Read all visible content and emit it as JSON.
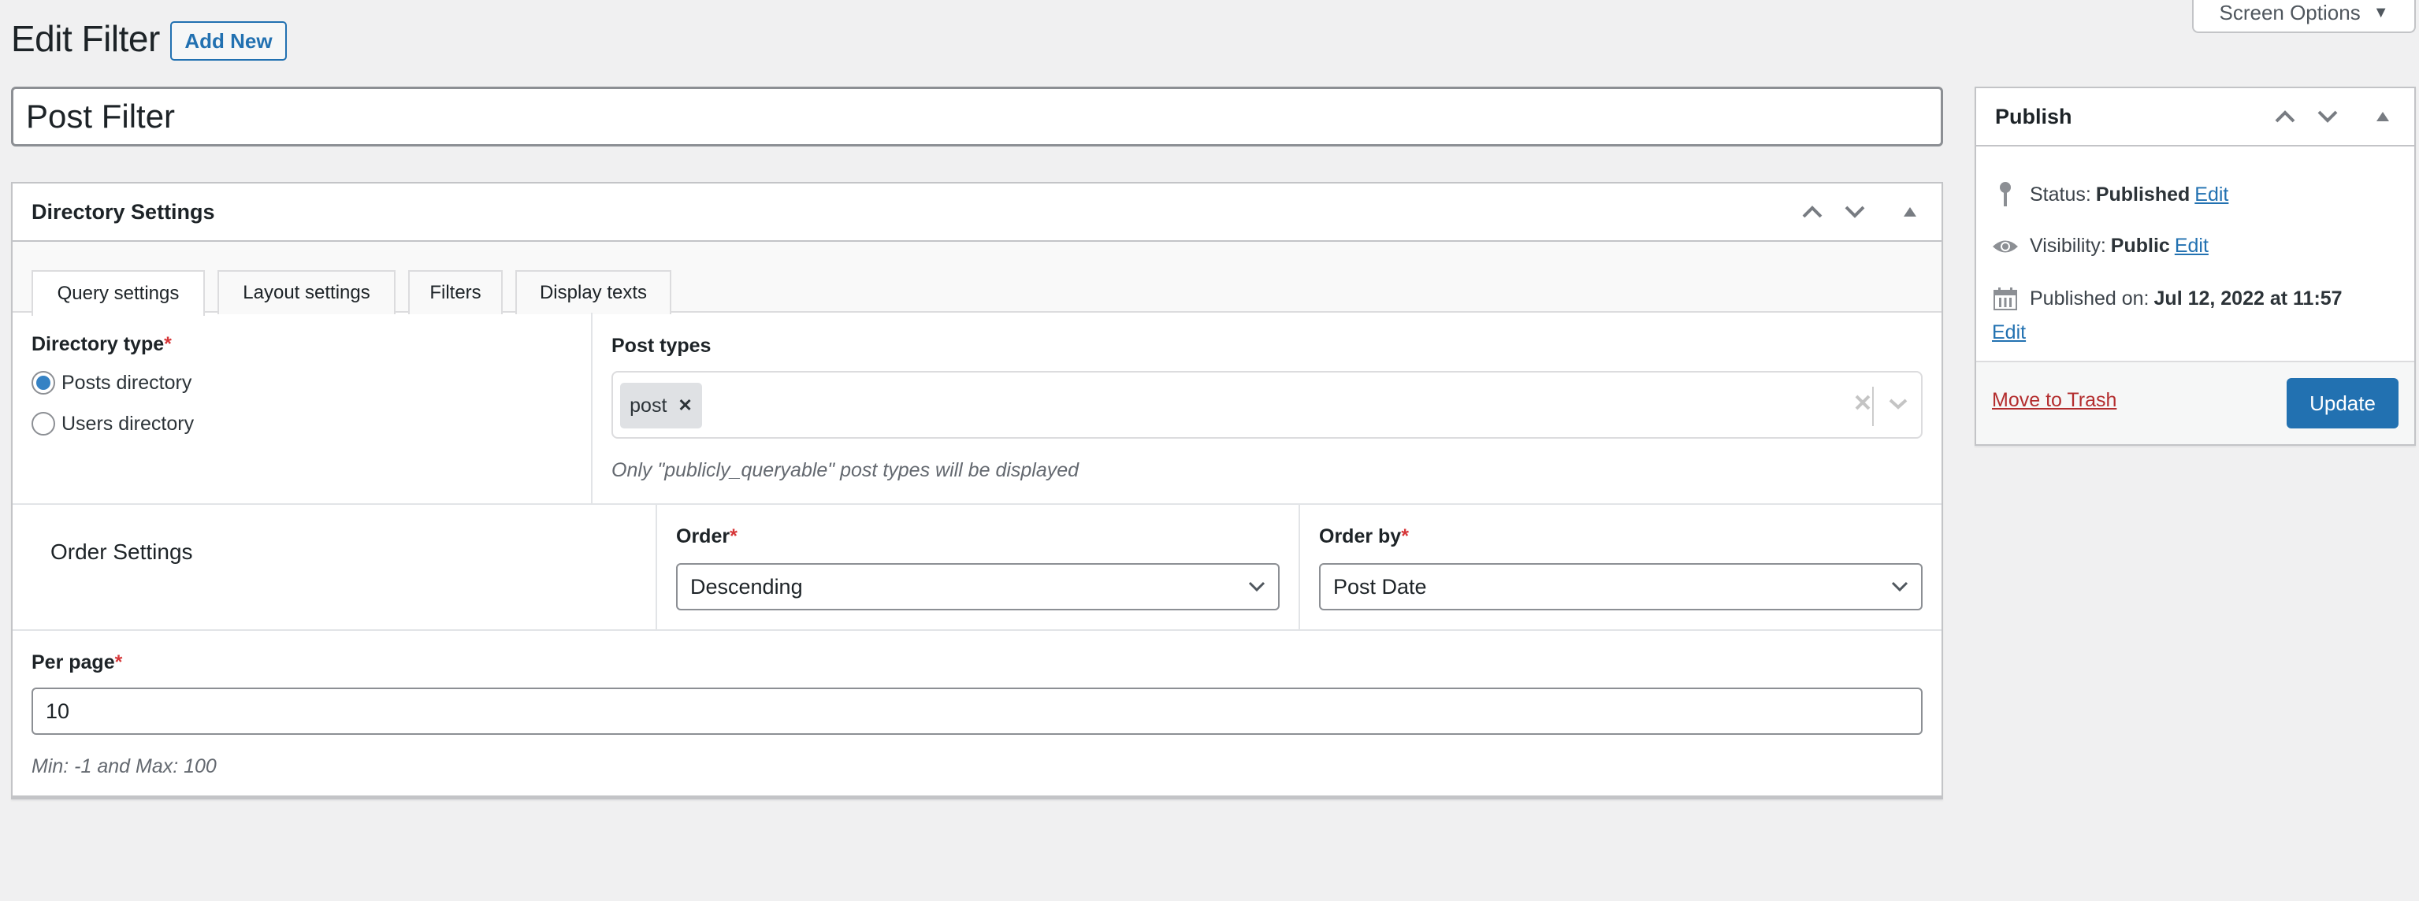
{
  "header": {
    "title": "Edit Filter",
    "add_new_label": "Add New",
    "screen_options_label": "Screen Options"
  },
  "post_title": {
    "value": "Post Filter"
  },
  "directory_settings": {
    "title": "Directory Settings",
    "tabs": [
      {
        "label": "Query settings",
        "active": true
      },
      {
        "label": "Layout settings",
        "active": false
      },
      {
        "label": "Filters",
        "active": false
      },
      {
        "label": "Display texts",
        "active": false
      }
    ],
    "directory_type": {
      "label": "Directory type",
      "required_mark": "*",
      "options": [
        {
          "label": "Posts directory",
          "checked": true
        },
        {
          "label": "Users directory",
          "checked": false
        }
      ]
    },
    "post_types": {
      "label": "Post types",
      "selected": [
        "post"
      ],
      "help": "Only \"publicly_queryable\" post types will be displayed"
    },
    "order_settings": {
      "section_label": "Order Settings",
      "order": {
        "label": "Order",
        "required_mark": "*",
        "value": "Descending"
      },
      "order_by": {
        "label": "Order by",
        "required_mark": "*",
        "value": "Post Date"
      }
    },
    "per_page": {
      "label": "Per page",
      "required_mark": "*",
      "value": "10",
      "help": "Min: -1 and Max: 100"
    }
  },
  "publish": {
    "title": "Publish",
    "status_label": "Status:",
    "status_value": "Published",
    "visibility_label": "Visibility:",
    "visibility_value": "Public",
    "published_on_label": "Published on:",
    "published_on_value": "Jul 12, 2022 at 11:57",
    "edit_label": "Edit",
    "move_to_trash_label": "Move to Trash",
    "update_label": "Update"
  },
  "colors": {
    "accent": "#2271b1",
    "danger": "#b32d2e",
    "required": "#d63638",
    "background": "#f0f0f1"
  }
}
